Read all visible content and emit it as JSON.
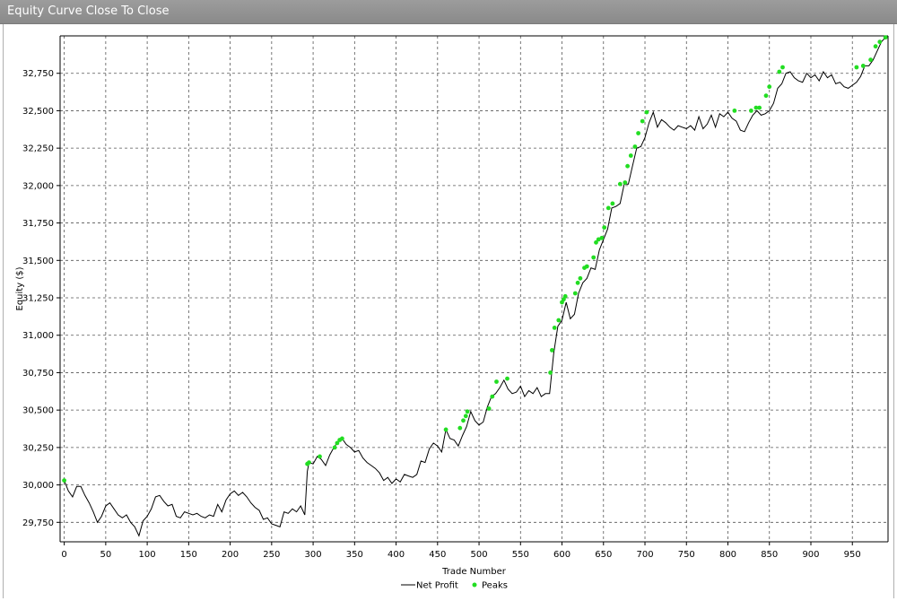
{
  "window": {
    "title": "Equity Curve Close To Close"
  },
  "colors": {
    "line": "#000000",
    "peak": "#22dd22",
    "grid": "#555555"
  },
  "chart_data": {
    "type": "line",
    "title": "Equity Curve Close To Close",
    "xlabel": "Trade Number",
    "ylabel": "Equity ($)",
    "xlim": [
      -5,
      993
    ],
    "ylim": [
      29620,
      33000
    ],
    "x_ticks": [
      0,
      50,
      100,
      150,
      200,
      250,
      300,
      350,
      400,
      450,
      500,
      550,
      600,
      650,
      700,
      750,
      800,
      850,
      900,
      950
    ],
    "y_ticks": [
      29750,
      30000,
      30250,
      30500,
      30750,
      31000,
      31250,
      31500,
      31750,
      32000,
      32250,
      32500,
      32750
    ],
    "y_tick_labels": [
      "29,750",
      "30,000",
      "30,250",
      "30,500",
      "30,750",
      "31,000",
      "31,250",
      "31,500",
      "31,750",
      "32,000",
      "32,250",
      "32,500",
      "32,750"
    ],
    "grid": true,
    "legend": {
      "position": "bottom-center",
      "entries": [
        "Net Profit",
        "Peaks"
      ]
    },
    "series": [
      {
        "name": "Net Profit",
        "kind": "line",
        "x": [
          0,
          5,
          10,
          15,
          20,
          25,
          30,
          35,
          40,
          45,
          50,
          55,
          60,
          65,
          70,
          75,
          80,
          85,
          90,
          95,
          100,
          105,
          110,
          115,
          120,
          125,
          130,
          135,
          140,
          145,
          150,
          155,
          160,
          165,
          170,
          175,
          180,
          185,
          190,
          195,
          200,
          205,
          210,
          215,
          220,
          225,
          230,
          235,
          240,
          245,
          250,
          255,
          260,
          265,
          270,
          275,
          280,
          285,
          290,
          293,
          295,
          300,
          305,
          310,
          315,
          320,
          325,
          330,
          335,
          340,
          345,
          350,
          355,
          360,
          365,
          370,
          375,
          380,
          385,
          390,
          395,
          400,
          405,
          410,
          415,
          420,
          425,
          430,
          435,
          440,
          445,
          450,
          455,
          460,
          465,
          470,
          475,
          480,
          485,
          490,
          495,
          500,
          505,
          510,
          515,
          520,
          525,
          530,
          535,
          540,
          545,
          550,
          555,
          560,
          565,
          570,
          575,
          580,
          585,
          590,
          595,
          600,
          605,
          610,
          615,
          620,
          625,
          630,
          635,
          640,
          645,
          650,
          655,
          660,
          665,
          670,
          675,
          680,
          685,
          690,
          695,
          700,
          705,
          710,
          715,
          720,
          725,
          730,
          735,
          740,
          745,
          750,
          755,
          760,
          765,
          770,
          775,
          780,
          785,
          790,
          795,
          800,
          805,
          810,
          815,
          820,
          825,
          830,
          835,
          840,
          845,
          850,
          855,
          860,
          865,
          870,
          875,
          880,
          885,
          890,
          895,
          900,
          905,
          910,
          915,
          920,
          925,
          930,
          935,
          940,
          945,
          950,
          955,
          960,
          965,
          970,
          975,
          980,
          985,
          990
        ],
        "values": [
          30030,
          29960,
          29920,
          29990,
          29990,
          29930,
          29880,
          29820,
          29750,
          29790,
          29860,
          29880,
          29840,
          29800,
          29780,
          29800,
          29750,
          29720,
          29660,
          29760,
          29790,
          29840,
          29920,
          29930,
          29890,
          29860,
          29870,
          29790,
          29780,
          29820,
          29810,
          29800,
          29810,
          29790,
          29780,
          29800,
          29790,
          29870,
          29820,
          29900,
          29940,
          29960,
          29930,
          29950,
          29920,
          29880,
          29850,
          29830,
          29770,
          29780,
          29740,
          29730,
          29720,
          29820,
          29810,
          29840,
          29820,
          29860,
          29800,
          30090,
          30150,
          30140,
          30190,
          30170,
          30130,
          30200,
          30250,
          30290,
          30310,
          30270,
          30250,
          30220,
          30230,
          30180,
          30150,
          30130,
          30110,
          30080,
          30030,
          30050,
          30010,
          30040,
          30020,
          30070,
          30060,
          30050,
          30070,
          30160,
          30150,
          30240,
          30280,
          30260,
          30220,
          30370,
          30310,
          30300,
          30260,
          30330,
          30390,
          30490,
          30430,
          30400,
          30420,
          30520,
          30590,
          30610,
          30650,
          30700,
          30640,
          30610,
          30620,
          30660,
          30590,
          30630,
          30610,
          30650,
          30590,
          30610,
          30610,
          30880,
          31060,
          31100,
          31220,
          31110,
          31140,
          31280,
          31350,
          31380,
          31450,
          31440,
          31570,
          31640,
          31710,
          31850,
          31860,
          31880,
          32010,
          32010,
          32130,
          32250,
          32260,
          32320,
          32420,
          32490,
          32390,
          32440,
          32420,
          32390,
          32370,
          32400,
          32390,
          32380,
          32400,
          32370,
          32460,
          32380,
          32410,
          32470,
          32390,
          32480,
          32460,
          32490,
          32450,
          32430,
          32370,
          32360,
          32420,
          32470,
          32500,
          32470,
          32480,
          32500,
          32550,
          32650,
          32680,
          32750,
          32760,
          32720,
          32700,
          32690,
          32750,
          32720,
          32740,
          32700,
          32760,
          32720,
          32740,
          32680,
          32690,
          32660,
          32650,
          32670,
          32690,
          32730,
          32800,
          32800,
          32840,
          32900,
          32960,
          32990
        ]
      },
      {
        "name": "Peaks",
        "kind": "points",
        "x": [
          0,
          293,
          295,
          308,
          326,
          329,
          332,
          335,
          460,
          477,
          481,
          484,
          486,
          512,
          516,
          521,
          534,
          586,
          588,
          591,
          596,
          600,
          602,
          604,
          616,
          619,
          622,
          627,
          630,
          638,
          641,
          644,
          648,
          651,
          656,
          661,
          670,
          676,
          679,
          683,
          688,
          692,
          697,
          702,
          808,
          828,
          834,
          838,
          846,
          850,
          862,
          866,
          955,
          963,
          972,
          978,
          983,
          990
        ],
        "values": [
          30030,
          30140,
          30150,
          30190,
          30250,
          30280,
          30300,
          30310,
          30370,
          30380,
          30430,
          30460,
          30490,
          30510,
          30590,
          30690,
          30710,
          30750,
          30900,
          31050,
          31100,
          31220,
          31240,
          31260,
          31280,
          31350,
          31380,
          31450,
          31460,
          31520,
          31620,
          31640,
          31650,
          31720,
          31850,
          31880,
          32010,
          32020,
          32130,
          32200,
          32260,
          32350,
          32430,
          32490,
          32500,
          32500,
          32520,
          32520,
          32600,
          32660,
          32760,
          32790,
          32790,
          32800,
          32840,
          32930,
          32960,
          32990
        ]
      }
    ]
  }
}
